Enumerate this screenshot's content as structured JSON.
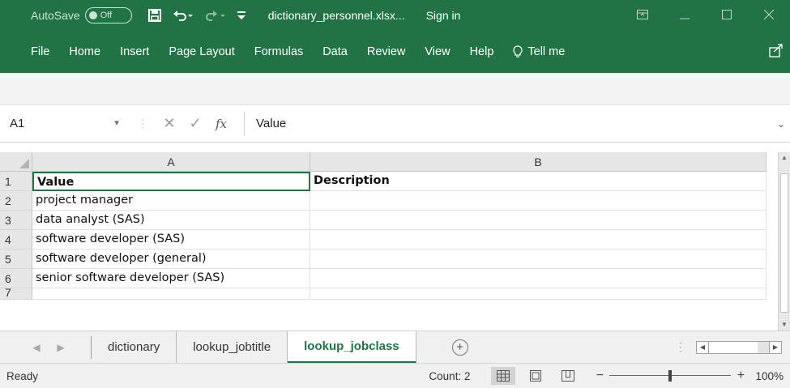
{
  "titlebar": {
    "autosave_label": "AutoSave",
    "autosave_state": "Off",
    "filename": "dictionary_personnel.xlsx...",
    "signin": "Sign in",
    "controls": [
      "restore-ribbon-icon",
      "minimize-icon",
      "maximize-icon",
      "close-icon"
    ]
  },
  "ribbon": {
    "tabs": [
      "File",
      "Home",
      "Insert",
      "Page Layout",
      "Formulas",
      "Data",
      "Review",
      "View",
      "Help"
    ],
    "tell_me": "Tell me"
  },
  "formula_bar": {
    "name_box": "A1",
    "formula": "Value"
  },
  "grid": {
    "columns": [
      "A",
      "B"
    ],
    "rows": [
      "1",
      "2",
      "3",
      "4",
      "5",
      "6",
      "7"
    ],
    "cells": [
      [
        "Value",
        "Description"
      ],
      [
        "project manager",
        ""
      ],
      [
        "data analyst (SAS)",
        ""
      ],
      [
        "software developer (SAS)",
        ""
      ],
      [
        "software developer (general)",
        ""
      ],
      [
        "senior software developer (SAS)",
        ""
      ],
      [
        "",
        ""
      ]
    ]
  },
  "sheets": {
    "tabs": [
      "dictionary",
      "lookup_jobtitle",
      "lookup_jobclass"
    ],
    "active": "lookup_jobclass"
  },
  "status": {
    "mode": "Ready",
    "count": "Count: 2",
    "zoom": "100%",
    "zoom_level": 100
  },
  "colors": {
    "brand": "#217346",
    "active_sheet_text": "#217346"
  }
}
